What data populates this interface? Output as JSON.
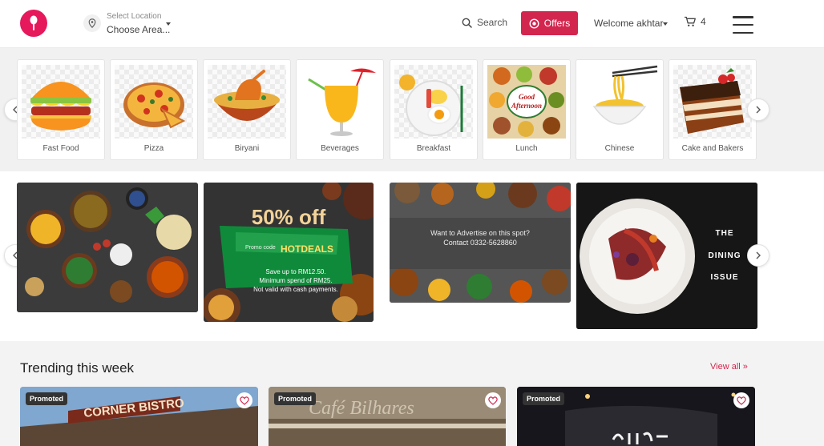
{
  "header": {
    "location_label": "Select Location",
    "location_value": "Choose Area...",
    "search_label": "Search",
    "offers_label": "Offers",
    "welcome_text": "Welcome akhtar",
    "cart_count": "4"
  },
  "colors": {
    "brand": "#e5195c",
    "accent": "#d3264f"
  },
  "categories": [
    {
      "label": "Fast Food",
      "icon": "burger-icon"
    },
    {
      "label": "Pizza",
      "icon": "pizza-icon"
    },
    {
      "label": "Biryani",
      "icon": "biryani-icon"
    },
    {
      "label": "Beverages",
      "icon": "beverage-icon"
    },
    {
      "label": "Breakfast",
      "icon": "breakfast-icon"
    },
    {
      "label": "Lunch",
      "icon": "lunch-icon"
    },
    {
      "label": "Chinese",
      "icon": "noodles-icon"
    },
    {
      "label": "Cake and Bakers",
      "icon": "cake-icon"
    }
  ],
  "banners": {
    "deal_headline": "50% off",
    "promo_prefix": "Promo code",
    "promo_code": "HOTDEALS",
    "deal_line1": "Save up to RM12.50.",
    "deal_line2": "Minimum spend of RM25.",
    "deal_line3": "Not valid with cash payments.",
    "advertise_line1": "Want to Advertise on this spot?",
    "advertise_line2": "Contact 0332-5628860",
    "dining_line1": "THE",
    "dining_line2": "DINING",
    "dining_line3": "ISSUE"
  },
  "trending": {
    "title": "Trending this week",
    "view_all": "View all",
    "cards": [
      {
        "badge": "Promoted",
        "sign": "CORNER BISTRO"
      },
      {
        "badge": "Promoted",
        "sign": "Café Bilhares"
      },
      {
        "badge": "Promoted",
        "sign": ""
      }
    ]
  }
}
